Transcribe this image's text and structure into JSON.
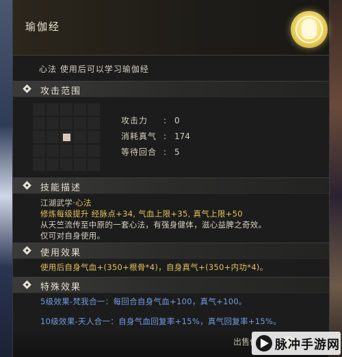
{
  "skill": {
    "title": "瑜伽经",
    "category_line": "心法  使用后可以学习瑜伽经"
  },
  "sections": {
    "attack_range": "攻击范围",
    "skill_desc": "技能描述",
    "use_effect": "使用效果",
    "special_effect": "特殊效果"
  },
  "stats": [
    {
      "label": "攻击力",
      "value": "0"
    },
    {
      "label": "消耗真气",
      "value": "174"
    },
    {
      "label": "等待回合",
      "value": "5"
    }
  ],
  "description": {
    "school_prefix": "江湖武学·",
    "school_type": "心法",
    "bonus_line": "修炼每级提升 经脉点+34, 气血上限+35, 真气上限+50",
    "lore_line1": "从天竺流传至中原的一套心法，有强身健体，滋心益脾之奇效。",
    "lore_line2": "仅可对自身使用。"
  },
  "use_effect_text": "使用后自身气血+(350+根骨*4)，自身真气+(350+内功*4)。",
  "special_effects": [
    "5级效果-梵我合一：每回合自身气血+100，真气+100。",
    "10级效果-天人合一：自身气血回复率+15%，真气回复率+15%。"
  ],
  "footer": {
    "sell_label": "出售价格：",
    "watermark_text": "脉冲手游网"
  },
  "icons": {
    "emblem": "portrait-emblem-icon",
    "section_marker": "diamond-icon",
    "watermark_logo": "play-logo-icon"
  },
  "colors": {
    "accent_gold": "#e2c25a",
    "effect_blue": "#6f9ee6",
    "emblem_gold": "#f2dc70"
  }
}
